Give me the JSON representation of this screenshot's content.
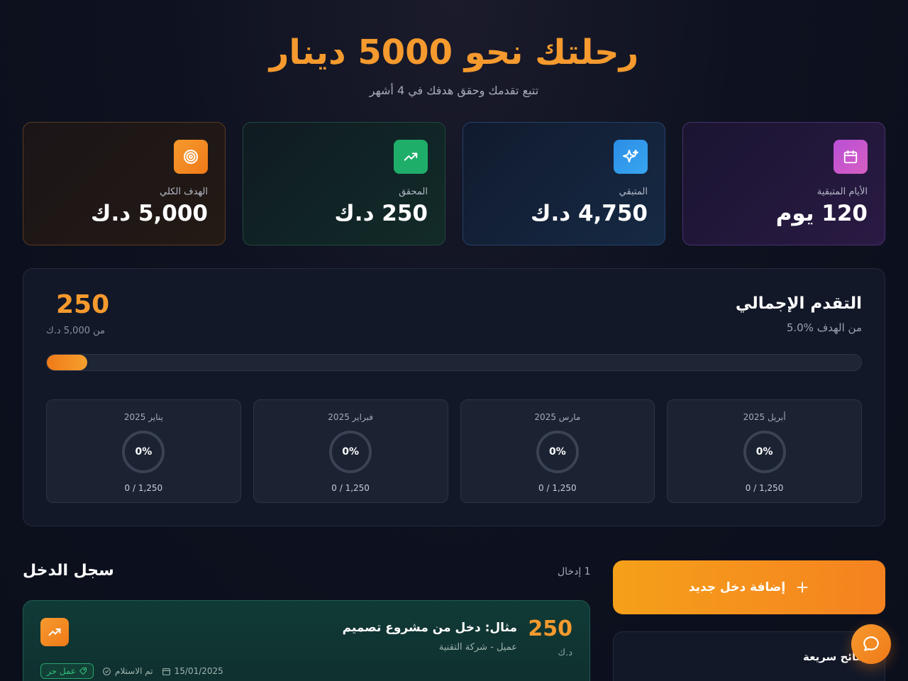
{
  "hero": {
    "title": "رحلتك نحو 5000 دينار",
    "subtitle": "تتبع تقدمك وحقق هدفك في 4 أشهر"
  },
  "stats": [
    {
      "label": "الأيام المتبقية",
      "value": "120 يوم",
      "icon": "calendar-icon"
    },
    {
      "label": "المتبقي",
      "value": "4,750 د.ك",
      "icon": "sparkles-icon"
    },
    {
      "label": "المحقق",
      "value": "250 د.ك",
      "icon": "trending-up-icon"
    },
    {
      "label": "الهدف الكلي",
      "value": "5,000 د.ك",
      "icon": "target-icon"
    }
  ],
  "progress": {
    "title": "التقدم الإجمالي",
    "subtitle": "5.0% من الهدف",
    "amount": "250",
    "of_text": "من 5,000 د.ك",
    "percent": 5.0
  },
  "months": [
    {
      "name": "أبريل 2025",
      "percent": "0%",
      "value": "0 / 1,250"
    },
    {
      "name": "مارس 2025",
      "percent": "0%",
      "value": "0 / 1,250"
    },
    {
      "name": "فبراير 2025",
      "percent": "0%",
      "value": "0 / 1,250"
    },
    {
      "name": "يناير 2025",
      "percent": "0%",
      "value": "0 / 1,250"
    }
  ],
  "income_log": {
    "title": "سجل الدخل",
    "count": "1 إدخال"
  },
  "entry": {
    "amount": "250",
    "currency": "د.ك",
    "title": "مثال: دخل من مشروع تصميم",
    "source": "عميل - شركة التقنية",
    "date": "15/01/2025",
    "status": "تم الاستلام",
    "tag": "عمل حر"
  },
  "add_button": {
    "label": "إضافة دخل جديد"
  },
  "tips": {
    "title": "نصائح سريعة"
  },
  "colors": {
    "accent": "#f59a2e",
    "success": "#1fae6a",
    "background": "#0e1220"
  }
}
